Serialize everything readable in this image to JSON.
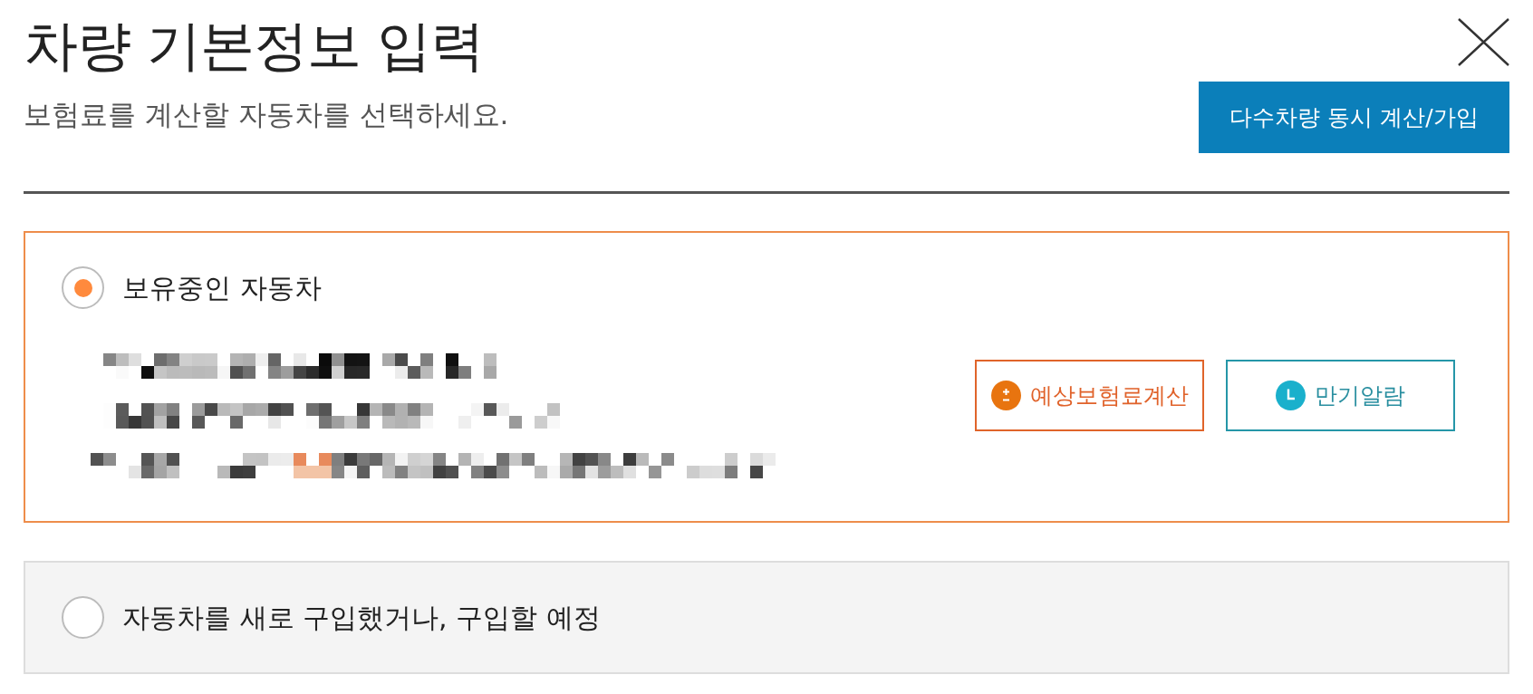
{
  "dialog": {
    "title": "차량 기본정보 입력",
    "subtitle": "보험료를 계산할 자동차를 선택하세요.",
    "multi_vehicle_button": "다수차량 동시 계산/가입"
  },
  "options": [
    {
      "label": "보유중인 자동차",
      "selected": true,
      "details": [
        {
          "kind": "redacted"
        },
        {
          "kind": "redacted"
        },
        {
          "kind": "redacted"
        }
      ],
      "actions": [
        {
          "kind": "estimate",
          "label": "예상보험료계산"
        },
        {
          "kind": "alarm",
          "label": "만기알람"
        }
      ]
    },
    {
      "label": "자동차를 새로 구입했거나, 구입할 예정",
      "selected": false
    }
  ]
}
